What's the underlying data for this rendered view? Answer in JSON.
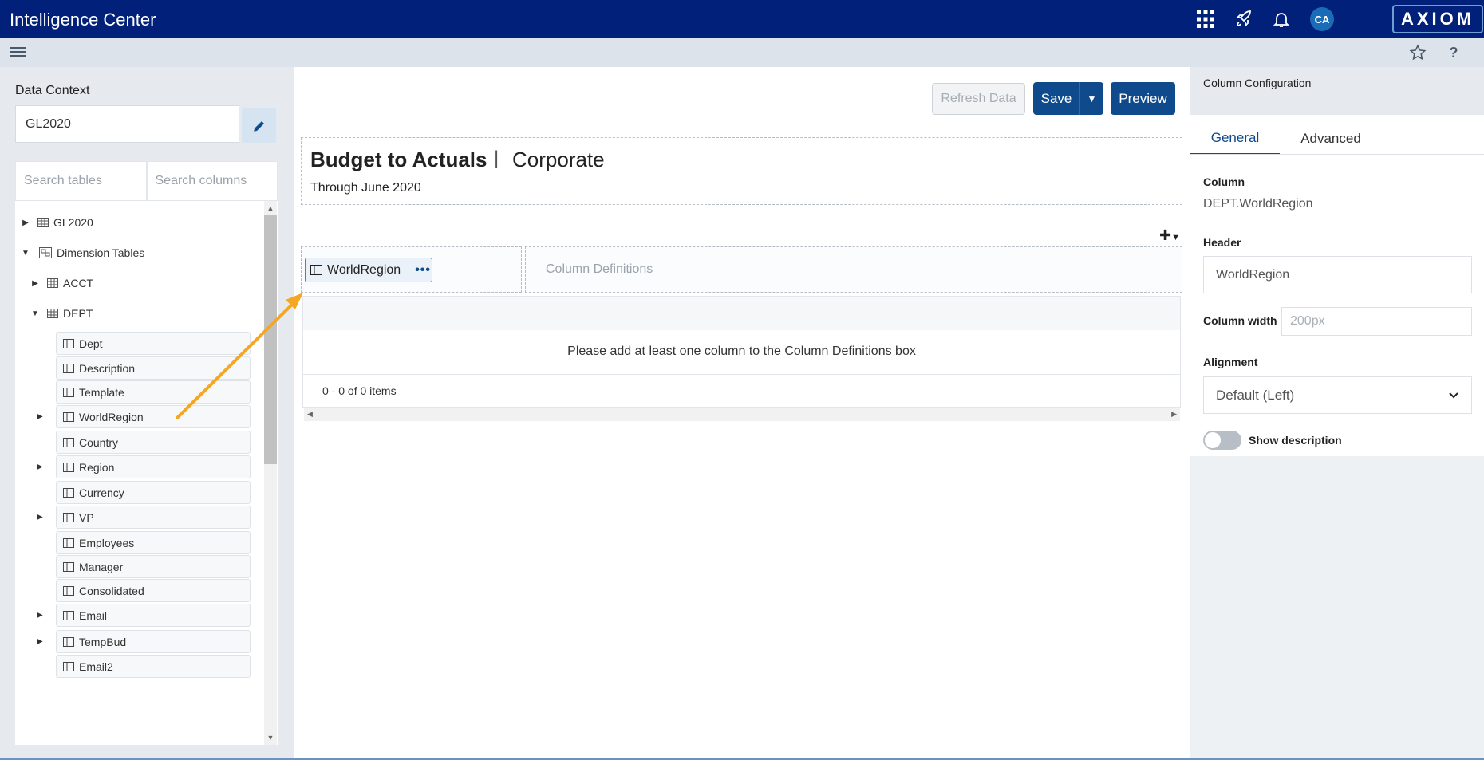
{
  "app": {
    "title": "Intelligence Center",
    "logo": "AXIOM",
    "avatar_initials": "CA"
  },
  "topbar_icons": [
    "grid-icon",
    "rocket-icon",
    "bell-icon"
  ],
  "left_panel": {
    "data_context_label": "Data Context",
    "data_context_value": "GL2020",
    "search_tables_placeholder": "Search tables",
    "search_columns_placeholder": "Search columns",
    "tree": {
      "gl2020": "GL2020",
      "dimension_tables": "Dimension Tables",
      "acct": "ACCT",
      "dept": "DEPT",
      "dept_columns": [
        {
          "label": "Dept",
          "expandable": false
        },
        {
          "label": "Description",
          "expandable": false
        },
        {
          "label": "Template",
          "expandable": false
        },
        {
          "label": "WorldRegion",
          "expandable": true
        },
        {
          "label": "Country",
          "expandable": false
        },
        {
          "label": "Region",
          "expandable": true
        },
        {
          "label": "Currency",
          "expandable": false
        },
        {
          "label": "VP",
          "expandable": true
        },
        {
          "label": "Employees",
          "expandable": false
        },
        {
          "label": "Manager",
          "expandable": false
        },
        {
          "label": "Consolidated",
          "expandable": false
        },
        {
          "label": "Email",
          "expandable": true
        },
        {
          "label": "TempBud",
          "expandable": true
        },
        {
          "label": "Email2",
          "expandable": false
        }
      ]
    }
  },
  "main": {
    "refresh_label": "Refresh Data",
    "save_label": "Save",
    "preview_label": "Preview",
    "report_title": "Budget to Actuals",
    "title_separator": "|",
    "report_subtitle": "Corporate",
    "report_date": "Through June 2020",
    "row_chip_label": "WorldRegion",
    "column_definitions_placeholder": "Column Definitions",
    "grid_message": "Please add at least one column to the Column Definitions box",
    "grid_footer": "0 - 0 of 0 items"
  },
  "right_panel": {
    "title": "Column Configuration",
    "tabs": [
      "General",
      "Advanced"
    ],
    "active_tab": "General",
    "column_label": "Column",
    "column_value": "DEPT.WorldRegion",
    "header_label": "Header",
    "header_value": "WorldRegion",
    "width_label": "Column width",
    "width_placeholder": "200px",
    "alignment_label": "Alignment",
    "alignment_value": "Default (Left)",
    "show_description_label": "Show description",
    "show_description_on": false
  },
  "colors": {
    "topbar": "#01207a",
    "primary": "#0e4a8c",
    "arrow": "#f5a623"
  }
}
